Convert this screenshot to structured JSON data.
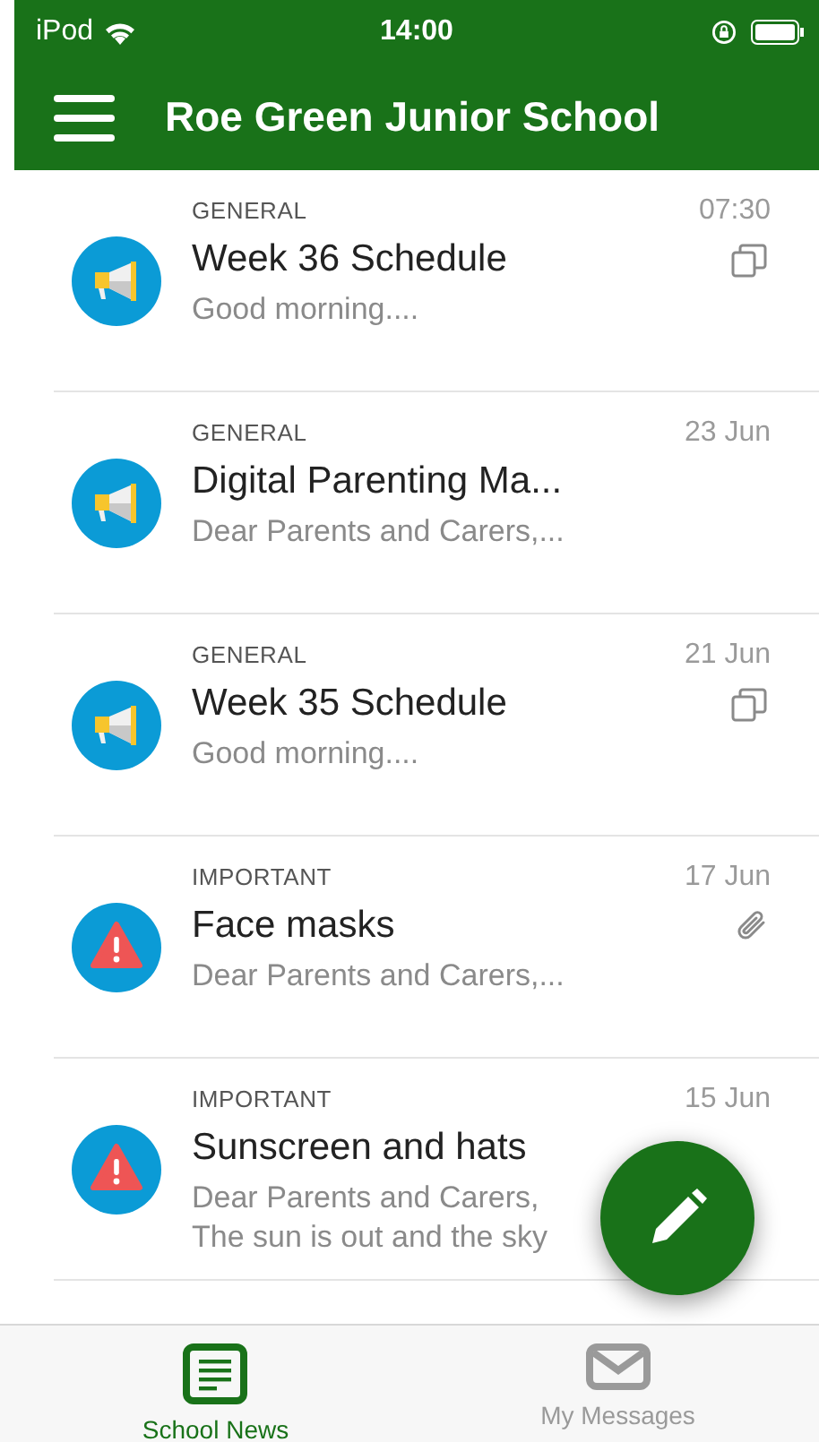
{
  "status_bar": {
    "carrier": "iPod",
    "time": "14:00"
  },
  "header": {
    "title": "Roe Green Junior School"
  },
  "posts": [
    {
      "kind": "general",
      "category": "GENERAL",
      "date": "07:30",
      "title": "Week 36 Schedule",
      "preview": "Good morning....",
      "multiple_pages": true,
      "has_attachment": false
    },
    {
      "kind": "general",
      "category": "GENERAL",
      "date": "23 Jun",
      "title": "Digital Parenting Ma...",
      "preview": "Dear Parents and Carers,...",
      "multiple_pages": false,
      "has_attachment": false
    },
    {
      "kind": "general",
      "category": "GENERAL",
      "date": "21 Jun",
      "title": "Week 35 Schedule",
      "preview": "Good morning....",
      "multiple_pages": true,
      "has_attachment": false
    },
    {
      "kind": "important",
      "category": "IMPORTANT",
      "date": "17 Jun",
      "title": "Face masks",
      "preview": "Dear Parents and Carers,...",
      "multiple_pages": false,
      "has_attachment": true
    },
    {
      "kind": "important",
      "category": "IMPORTANT",
      "date": "15 Jun",
      "title": "Sunscreen and hats",
      "preview": "Dear Parents and Carers,\nThe sun is out and the sky",
      "multiple_pages": false,
      "has_attachment": false
    }
  ],
  "tabs": [
    {
      "kind": "news",
      "label": "School News",
      "selected": true
    },
    {
      "kind": "messages",
      "label": "My Messages",
      "selected": false
    }
  ]
}
